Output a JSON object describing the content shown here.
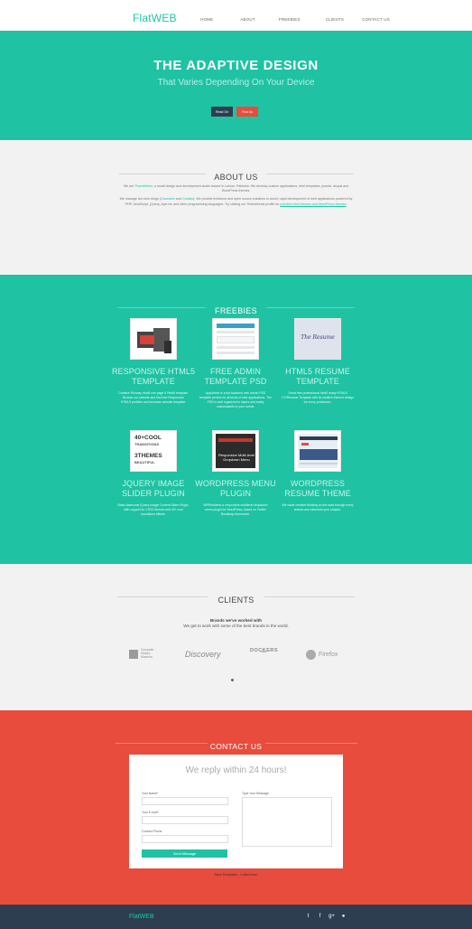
{
  "nav": {
    "brand": "FlatWEB",
    "links": [
      "HOME",
      "ABOUT",
      "FREEBIES",
      "CLIENTS",
      "CONTACT US"
    ]
  },
  "hero": {
    "title": "THE ADAPTIVE DESIGN",
    "subtitle": "That Varies Depending On Your Device",
    "btn_primary": "Read On",
    "btn_secondary": "Find Us"
  },
  "about": {
    "title": "ABOUT US",
    "p1_pre": "We are ",
    "p1_link": "Themefisher",
    "p1_post": ", a small design and development studio based in Lahore, Pakistan. We develop custom applications, html templates, joomla, drupal and WordPress themes.",
    "p2_pre": "We manage two tech blogs (",
    "p2_link1": "Cssmanix",
    "p2_mid": " and ",
    "p2_link2": "Codalio",
    "p2_post": "). We provide freelance and open source solutions to world, rapid development of web applications powered by PHP, JavaScript, jQuery, Ajax etc and other programming languages. Try visiting our Themeforest profile for ",
    "p2_link3": "premium html themes and WordPress themes",
    "p2_end": "."
  },
  "freebies": {
    "title": "FREEBIES",
    "items": [
      {
        "title": "RESPONSIVE HTML5 TEMPLATE",
        "desc": "Creative Runway html5 one page 5 Html5 template. Browse our website and find free Responsive HTML5 portfolio and business website template."
      },
      {
        "title": "FREE ADMIN TEMPLATE PSD",
        "desc": "AppAdmin is a fun backend web admin PSD template perfect for all kinds of web applications. The PSD is well organized in layers and easily customizable to your needs."
      },
      {
        "title": "HTML5 RESUME TEMPLATE",
        "desc": "Great free professional html5 ready HTML5 CV/Resume Template with its intuitive themed design for every profession."
      },
      {
        "title": "JQUERY IMAGE SLIDER PLUGIN",
        "desc": "Basic Awesome jQuery Image Content Slider Plugin, with support for CSS3 themes and 40+ cool transitions effects."
      },
      {
        "title": "WORDPRESS MENU PLUGIN",
        "desc": "WPResMenu a responsive multilevel dropdown menu plugin for WordPress, based on Twitter Bootstrap framework."
      },
      {
        "title": "WORDPRESS RESUME THEME",
        "desc": "We value creative thinking on the road through every texture and elements your shapes."
      }
    ],
    "thumb4_lines": [
      "40+COOL",
      "TRANSITIONS",
      "3THEMES",
      "BEAUTIFUL"
    ],
    "thumb3_text": "The Resume",
    "thumb5_text": "Responsive Multi-level Dropdown Menu"
  },
  "clients": {
    "title": "CLIENTS",
    "intro_bold": "Brands we've worked with",
    "intro": "We get to work with some of the best brands in the world.",
    "logos": {
      "chm": [
        "Computer",
        "History",
        "Museum"
      ],
      "discovery": "Discovery",
      "dockers": "DOCKERS",
      "firefox": "Firefox"
    }
  },
  "contact": {
    "title": "CONTACT US",
    "form_head": "We reply within 24 hours!",
    "label_name": "Your Name*",
    "label_email": "Your E-mail*",
    "label_phone": "Contact Phone",
    "label_message": "Type Your Message",
    "send": "Send Message",
    "credit_pre": "More Templates ",
    "credit_link1": "",
    "credit_mid": " - Collect from ",
    "credit_link2": ""
  },
  "footer": {
    "brand": "FlatWEB",
    "social": [
      "twitter-icon",
      "facebook-icon",
      "google-plus-icon",
      "dribbble-icon"
    ]
  },
  "colors": {
    "teal": "#1fc2a3",
    "red": "#e74c3c",
    "navy": "#2c3e50",
    "light": "#f2f2f3"
  }
}
